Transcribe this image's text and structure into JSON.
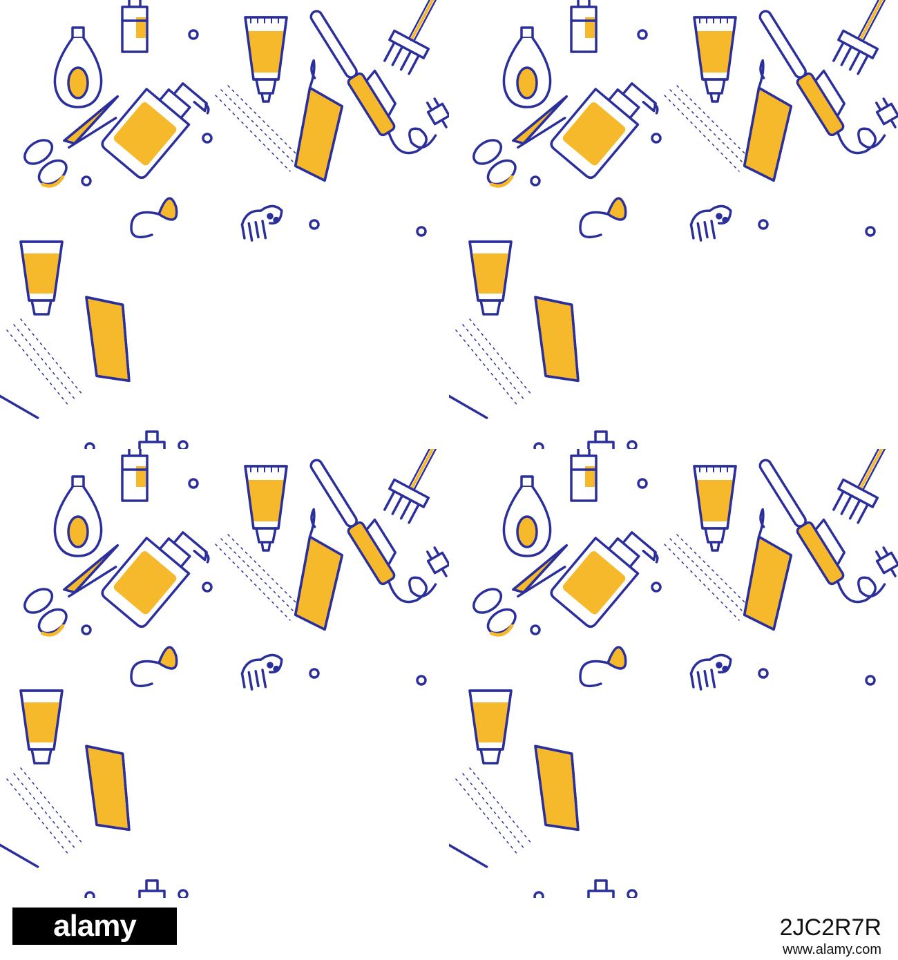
{
  "colors": {
    "background": "#ffffff",
    "outline": "#2b2f9c",
    "accent": "#f6b92b",
    "footer_text": "#111111",
    "logo_bg": "#000000"
  },
  "pattern": {
    "icons": [
      "spray-bottle-icon",
      "scissors-icon",
      "curling-iron-icon",
      "tint-brush-icon",
      "towel-icon",
      "cream-tube-icon",
      "shampoo-bottle-icon",
      "small-bottle-icon",
      "hair-clip-icon",
      "hair-pin-icon",
      "comb-icon",
      "dot-icon"
    ]
  },
  "footer": {
    "logo_text": "alamy",
    "image_id": "2JC2R7R",
    "site": "www.alamy.com"
  }
}
